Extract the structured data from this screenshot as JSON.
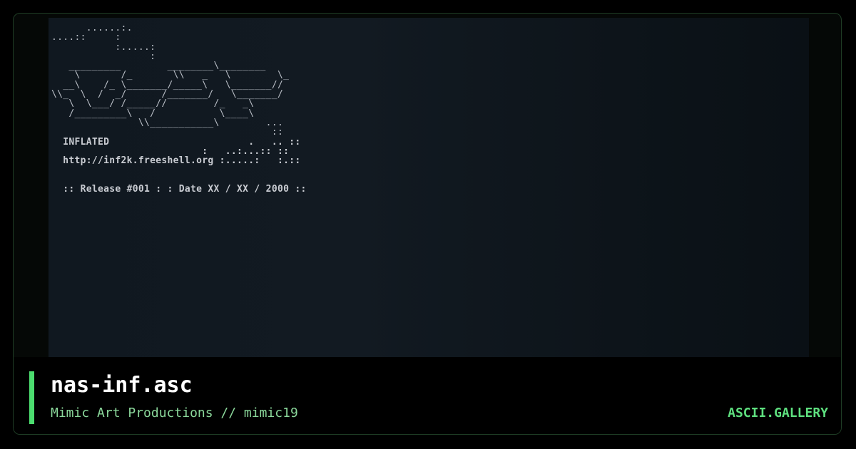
{
  "preview": {
    "ascii_art": "      ......:.\n....::     :\n           :.....:\n                 :\n   _________        ________\\________\n    \\       /_       \\\\   _   \\        \\_\n  __\\    /_ \\_______/_____\\   \\_______//\n\\\\_  \\  /  _/      /_______/   \\_______/\n   \\  \\___/ /_____//        /_   _\\\n   /_________\\   /           \\____\\\n               \\\\___________\\        ...\n                                      ::\n",
    "info_lines": [
      "  INFLATED                        .   .. ::",
      "                          :   ..:...:: ::",
      "  http://inf2k.freeshell.org :.....:   :.::",
      "",
      "",
      "  :: Release #001 : : Date XX / XX / 2000 ::"
    ]
  },
  "footer": {
    "title": "nas-inf.asc",
    "subtitle": "Mimic Art Productions // mimic19",
    "brand": "ASCII.GALLERY"
  },
  "colors": {
    "accent": "#4cdd6f",
    "subtitle": "#8bd89b",
    "brand": "#5ee07f",
    "card_border": "#1f3d25"
  }
}
